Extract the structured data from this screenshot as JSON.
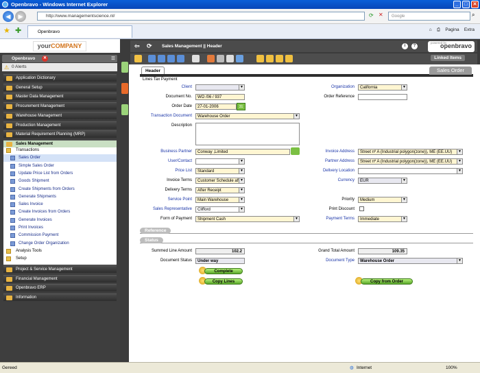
{
  "browser": {
    "title": "Openbravo - Windows Internet Explorer",
    "url": "http://www.managementscience.nl/",
    "search_placeholder": "Google",
    "tab": "Openbravo",
    "page_label": "Pagina",
    "tools_label": "Extra"
  },
  "status": {
    "left": "Gereed",
    "zone": "Internet",
    "zoom": "100%"
  },
  "sidebar": {
    "logo_a": "your",
    "logo_b": "COMPANY",
    "header": "Openbravo",
    "alerts": "0 Alerts",
    "menus": [
      "Application Dictionary",
      "General Setup",
      "Master Data Management",
      "Procurement Management",
      "Warehouse Management",
      "Production Management",
      "Material Requirement Planning (MRP)",
      "Sales Management"
    ],
    "submenu": [
      "Transactions",
      "Sales Order",
      "Simple Sales Order",
      "Update Price List from Orders",
      "Goods Shipment",
      "Create Shipments from Orders",
      "Generate Shipments",
      "Sales Invoice",
      "Create Invoices from Orders",
      "Generate Invoices",
      "Print Invoices",
      "Commission Payment",
      "Change Order Organization",
      "Analysis Tools",
      "Setup"
    ],
    "menus_after": [
      "Project & Service Management",
      "Financial Management",
      "Openbravo ERP",
      "Information"
    ]
  },
  "appbar": {
    "breadcrumb": "Sales Management  ||  Header",
    "brand": "openbravo",
    "brand_small": "powered by",
    "linked_items": "Linked Items"
  },
  "tabs": {
    "header": "Header",
    "subtabs": "Lines   Tax   Payment",
    "sales_order": "Sales Order"
  },
  "form": {
    "client": {
      "label": "Client",
      "value": ""
    },
    "organization": {
      "label": "Organization",
      "value": "California"
    },
    "document_no": {
      "label": "Document No.",
      "value": "WO /06 / 937"
    },
    "order_reference": {
      "label": "Order Reference",
      "value": ""
    },
    "order_date": {
      "label": "Order Date",
      "value": "27-01-2006"
    },
    "transaction_document": {
      "label": "Transaction Document",
      "value": "Warehouse Order"
    },
    "description": {
      "label": "Description",
      "value": ""
    },
    "business_partner": {
      "label": "Business Partner",
      "value": "Conway ,Limited"
    },
    "invoice_address": {
      "label": "Invoice Address",
      "value": "Street nº A (Industrial polygon(zone)), ME (EE.UU)"
    },
    "user_contact": {
      "label": "User/Contact",
      "value": ""
    },
    "partner_address": {
      "label": "Partner Address",
      "value": "Street nº A (Industrial polygon(zone)), ME (EE.UU)"
    },
    "price_list": {
      "label": "Price List",
      "value": "Standard"
    },
    "delivery_location": {
      "label": "Delivery Location",
      "value": ""
    },
    "invoice_terms": {
      "label": "Invoice Terms",
      "value": "Customer Schedule aft"
    },
    "currency": {
      "label": "Currency",
      "value": "EUR"
    },
    "delivery_terms": {
      "label": "Delivery Terms",
      "value": "After Receipt"
    },
    "service_point": {
      "label": "Service Point",
      "value": "Main Warehouse"
    },
    "priority": {
      "label": "Priority",
      "value": "Medium"
    },
    "sales_rep": {
      "label": "Sales Representative",
      "value": "Clifford"
    },
    "print_discount": {
      "label": "Print Discount"
    },
    "form_of_payment": {
      "label": "Form of Payment",
      "value": "Shipment Cash"
    },
    "payment_terms": {
      "label": "Payment Terms",
      "value": "Immediate"
    },
    "section_reference": "Reference",
    "section_status": "Status",
    "summed_line_amount": {
      "label": "Summed Line Amount",
      "value": "102.2"
    },
    "grand_total": {
      "label": "Grand Total Amount",
      "value": "109.35"
    },
    "document_status": {
      "label": "Document Status",
      "value": "Under way"
    },
    "document_type": {
      "label": "Document Type",
      "value": "Warehouse Order"
    },
    "btn_complete": "Complete",
    "btn_copy_lines": "Copy Lines",
    "btn_copy_from_order": "Copy from Order"
  }
}
